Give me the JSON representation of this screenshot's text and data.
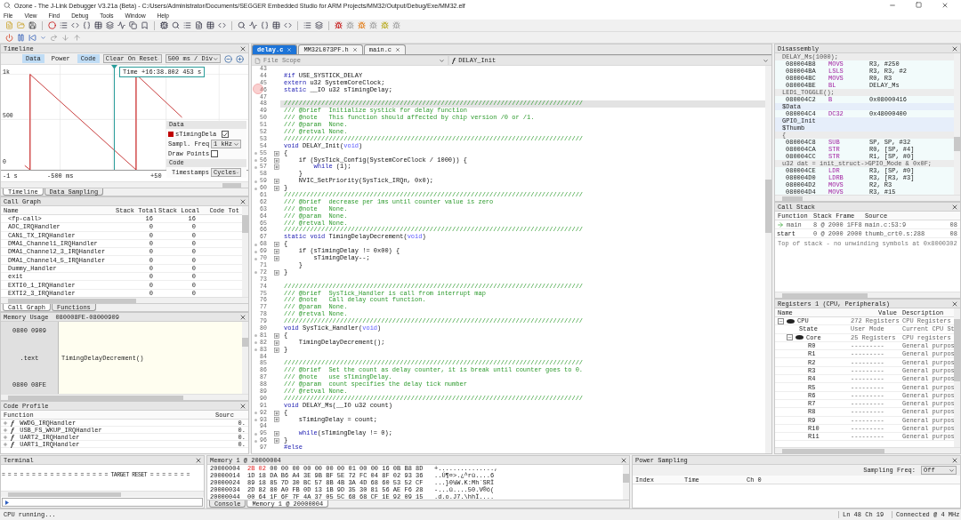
{
  "window": {
    "title": "Ozone - The J-Link Debugger V3.21a (Beta) - C:/Users/Administrator/Documents/SEGGER Embedded Studio for ARM Projects/MM32/Output/Debug/Exe/MM32.elf"
  },
  "menu": [
    "File",
    "View",
    "Find",
    "Debug",
    "Tools",
    "Window",
    "Help"
  ],
  "timeline": {
    "title": "Timeline",
    "modes": [
      {
        "label": "Data",
        "selected": true
      },
      {
        "label": "Power",
        "selected": false
      },
      {
        "label": "Code",
        "selected": true
      }
    ],
    "reset_mode": "Clear On Reset",
    "scale": "500 ms / Div",
    "cursor_time": "Time  +16:38.802 453 s",
    "y_labels": [
      "1k",
      "500",
      "0"
    ],
    "x_labels": [
      "-1 s",
      "-500 ms",
      "+50"
    ],
    "data_settings": {
      "title": "Data",
      "variable": "sTimingDela",
      "color": "#c00000",
      "visible": true,
      "freq_label": "Sampl. Freq",
      "freq": "1 kHz",
      "draw_points_label": "Draw Points",
      "draw_points": false
    },
    "code_settings": {
      "title": "Code",
      "timestamps_label": "Timestamps",
      "timestamps": "Cycles"
    },
    "tabs": [
      {
        "label": "Timeline",
        "selected": true
      },
      {
        "label": "Data Sampling",
        "selected": false
      }
    ]
  },
  "call_graph": {
    "title": "Call Graph",
    "columns": [
      "Name",
      "Stack Total",
      "Stack Local",
      "Code Tot"
    ],
    "rows": [
      [
        "<fp-call>",
        "16",
        "16"
      ],
      [
        "ADC_IRQHandler",
        "0",
        "0"
      ],
      [
        "CAN1_TX_IRQHandler",
        "0",
        "0"
      ],
      [
        "DMA1_Channel1_IRQHandler",
        "0",
        "0"
      ],
      [
        "DMA1_Channel2_3_IRQHandler",
        "0",
        "0"
      ],
      [
        "DMA1_Channel4_5_IRQHandler",
        "0",
        "0"
      ],
      [
        "Dummy_Handler",
        "0",
        "0"
      ],
      [
        "exit",
        "0",
        "0"
      ],
      [
        "EXTI0_1_IRQHandler",
        "0",
        "0"
      ],
      [
        "EXTI2_3_IRQHandler",
        "0",
        "0"
      ]
    ],
    "tabs": [
      {
        "label": "Call Graph",
        "selected": true
      },
      {
        "label": "Functions",
        "selected": false
      }
    ]
  },
  "memory_usage": {
    "title": "Memory Usage",
    "range": "080008FE-08000909",
    "end_address": "0800 0909",
    "section": ".text",
    "start_address": "0800 08FE",
    "symbol": "TimingDelayDecrement()"
  },
  "code_profile": {
    "title": "Code Profile",
    "columns": [
      "Function",
      "Sourc"
    ],
    "rows": [
      {
        "symbol": "ƒ",
        "name": "WWDG_IRQHandler",
        "source": "0."
      },
      {
        "symbol": "ƒ",
        "name": "USB_FS_WKUP_IRQHandler",
        "source": "0."
      },
      {
        "symbol": "ƒ",
        "name": "UART2_IRQHandler",
        "source": "0."
      },
      {
        "symbol": "ƒ",
        "name": "UART1_IRQHandler",
        "source": "0."
      }
    ]
  },
  "editor": {
    "tabs": [
      {
        "label": "delay.c",
        "selected": true
      },
      {
        "label": "MM32L073PF.h",
        "selected": false
      },
      {
        "label": "main.c",
        "selected": false
      }
    ],
    "scope": "File Scope",
    "scope_symbol": "ƒ",
    "function": "DELAY_Init",
    "lines": [
      {
        "n": "43",
        "current": false,
        "fold": false,
        "breakpoint": false
      },
      {
        "n": "44",
        "current": false,
        "fold": false,
        "breakpoint": false,
        "segs": [
          {
            "kind": "keyword",
            "text": "#if"
          },
          {
            "kind": "plain",
            "text": " USE_SYSTICK_DELAY"
          }
        ]
      },
      {
        "n": "45",
        "current": false,
        "fold": false,
        "breakpoint": false,
        "segs": [
          {
            "kind": "keyword",
            "text": "extern"
          },
          {
            "kind": "plain",
            "text": " u32 SystemCoreClock;"
          }
        ]
      },
      {
        "n": "46",
        "current": false,
        "fold": false,
        "breakpoint": true,
        "segs": [
          {
            "kind": "keyword",
            "text": "static"
          },
          {
            "kind": "plain",
            "text": " __IO u32 sTimingDelay;"
          }
        ]
      },
      {
        "n": "47",
        "current": false,
        "fold": false,
        "breakpoint": false
      },
      {
        "n": "48",
        "current": true,
        "fold": false,
        "breakpoint": false,
        "segs": [
          {
            "kind": "comment",
            "text": "////////////////////////////////////////////////////////////////////////////////"
          }
        ]
      },
      {
        "n": "49",
        "current": false,
        "fold": false,
        "breakpoint": false,
        "segs": [
          {
            "kind": "comment",
            "text": "/// @brief  Initialize systick for delay function"
          }
        ]
      },
      {
        "n": "50",
        "current": false,
        "fold": false,
        "breakpoint": false,
        "segs": [
          {
            "kind": "comment",
            "text": "/// @note   This function should affected by chip version /0 or /1."
          }
        ]
      },
      {
        "n": "51",
        "current": false,
        "fold": false,
        "breakpoint": false,
        "segs": [
          {
            "kind": "comment",
            "text": "/// @param  None."
          }
        ]
      },
      {
        "n": "52",
        "current": false,
        "fold": false,
        "breakpoint": false,
        "segs": [
          {
            "kind": "comment",
            "text": "/// @retval None."
          }
        ]
      },
      {
        "n": "53",
        "current": false,
        "fold": false,
        "breakpoint": false,
        "segs": [
          {
            "kind": "comment",
            "text": "////////////////////////////////////////////////////////////////////////////////"
          }
        ]
      },
      {
        "n": "54",
        "current": false,
        "fold": false,
        "breakpoint": false,
        "segs": [
          {
            "kind": "keyword",
            "text": "void"
          },
          {
            "kind": "plain",
            "text": " DELAY_Init("
          },
          {
            "kind": "type",
            "text": "void"
          },
          {
            "kind": "plain",
            "text": ")"
          }
        ]
      },
      {
        "n": "55",
        "current": false,
        "fold": true,
        "breakpoint": false,
        "segs": [
          {
            "kind": "plain",
            "text": "{"
          }
        ]
      },
      {
        "n": "56",
        "current": false,
        "fold": true,
        "breakpoint": false,
        "segs": [
          {
            "kind": "plain",
            "text": "    if (SysTick_Config(SystemCoreClock / 1000)) {"
          }
        ]
      },
      {
        "n": "57",
        "current": false,
        "fold": true,
        "breakpoint": false,
        "segs": [
          {
            "kind": "keyword",
            "text": "        while"
          },
          {
            "kind": "plain",
            "text": " (1);"
          }
        ]
      },
      {
        "n": "58",
        "current": false,
        "fold": false,
        "breakpoint": false,
        "segs": [
          {
            "kind": "plain",
            "text": "    }"
          }
        ]
      },
      {
        "n": "59",
        "current": false,
        "fold": true,
        "breakpoint": false,
        "segs": [
          {
            "kind": "plain",
            "text": "    NVIC_SetPriority(SysTick_IRQn, 0x0);"
          }
        ]
      },
      {
        "n": "60",
        "current": false,
        "fold": true,
        "breakpoint": false,
        "segs": [
          {
            "kind": "plain",
            "text": "}"
          }
        ]
      },
      {
        "n": "61",
        "current": false,
        "fold": false,
        "breakpoint": false,
        "segs": [
          {
            "kind": "comment",
            "text": "////////////////////////////////////////////////////////////////////////////////"
          }
        ]
      },
      {
        "n": "62",
        "current": false,
        "fold": false,
        "breakpoint": false,
        "segs": [
          {
            "kind": "comment",
            "text": "/// @brief  decrease per 1ms until counter value is zero"
          }
        ]
      },
      {
        "n": "63",
        "current": false,
        "fold": false,
        "breakpoint": false,
        "segs": [
          {
            "kind": "comment",
            "text": "/// @note   None."
          }
        ]
      },
      {
        "n": "64",
        "current": false,
        "fold": false,
        "breakpoint": false,
        "segs": [
          {
            "kind": "comment",
            "text": "/// @param  None."
          }
        ]
      },
      {
        "n": "65",
        "current": false,
        "fold": false,
        "breakpoint": false,
        "segs": [
          {
            "kind": "comment",
            "text": "/// @retval None."
          }
        ]
      },
      {
        "n": "66",
        "current": false,
        "fold": false,
        "breakpoint": false,
        "segs": [
          {
            "kind": "comment",
            "text": "////////////////////////////////////////////////////////////////////////////////"
          }
        ]
      },
      {
        "n": "67",
        "current": false,
        "fold": false,
        "breakpoint": false,
        "segs": [
          {
            "kind": "keyword",
            "text": "static void"
          },
          {
            "kind": "plain",
            "text": " TimingDelayDecrement("
          },
          {
            "kind": "type",
            "text": "void"
          },
          {
            "kind": "plain",
            "text": ")"
          }
        ]
      },
      {
        "n": "68",
        "current": false,
        "fold": true,
        "breakpoint": false,
        "segs": [
          {
            "kind": "plain",
            "text": "{"
          }
        ]
      },
      {
        "n": "69",
        "current": false,
        "fold": true,
        "breakpoint": false,
        "segs": [
          {
            "kind": "plain",
            "text": "    if (sTimingDelay != 0x00) {"
          }
        ]
      },
      {
        "n": "70",
        "current": false,
        "fold": true,
        "breakpoint": false,
        "segs": [
          {
            "kind": "plain",
            "text": "        sTimingDelay--;"
          }
        ]
      },
      {
        "n": "71",
        "current": false,
        "fold": false,
        "breakpoint": false,
        "segs": [
          {
            "kind": "plain",
            "text": "    }"
          }
        ]
      },
      {
        "n": "72",
        "current": false,
        "fold": true,
        "breakpoint": false,
        "segs": [
          {
            "kind": "plain",
            "text": "}"
          }
        ]
      },
      {
        "n": "73",
        "current": false,
        "fold": false,
        "breakpoint": false
      },
      {
        "n": "74",
        "current": false,
        "fold": false,
        "breakpoint": false,
        "segs": [
          {
            "kind": "comment",
            "text": "////////////////////////////////////////////////////////////////////////////////"
          }
        ]
      },
      {
        "n": "75",
        "current": false,
        "fold": false,
        "breakpoint": false,
        "segs": [
          {
            "kind": "comment",
            "text": "/// @brief  SysTick_Handler is call from interrupt map"
          }
        ]
      },
      {
        "n": "76",
        "current": false,
        "fold": false,
        "breakpoint": false,
        "segs": [
          {
            "kind": "comment",
            "text": "/// @note   Call delay count function."
          }
        ]
      },
      {
        "n": "77",
        "current": false,
        "fold": false,
        "breakpoint": false,
        "segs": [
          {
            "kind": "comment",
            "text": "/// @param  None."
          }
        ]
      },
      {
        "n": "78",
        "current": false,
        "fold": false,
        "breakpoint": false,
        "segs": [
          {
            "kind": "comment",
            "text": "/// @retval None."
          }
        ]
      },
      {
        "n": "79",
        "current": false,
        "fold": false,
        "breakpoint": false,
        "segs": [
          {
            "kind": "comment",
            "text": "////////////////////////////////////////////////////////////////////////////////"
          }
        ]
      },
      {
        "n": "80",
        "current": false,
        "fold": false,
        "breakpoint": false,
        "segs": [
          {
            "kind": "keyword",
            "text": "void"
          },
          {
            "kind": "plain",
            "text": " SysTick_Handler("
          },
          {
            "kind": "type",
            "text": "void"
          },
          {
            "kind": "plain",
            "text": ")"
          }
        ]
      },
      {
        "n": "81",
        "current": false,
        "fold": true,
        "breakpoint": false,
        "segs": [
          {
            "kind": "plain",
            "text": "{"
          }
        ]
      },
      {
        "n": "82",
        "current": false,
        "fold": true,
        "breakpoint": false,
        "segs": [
          {
            "kind": "plain",
            "text": "    TimingDelayDecrement();"
          }
        ]
      },
      {
        "n": "83",
        "current": false,
        "fold": true,
        "breakpoint": false,
        "segs": [
          {
            "kind": "plain",
            "text": "}"
          }
        ]
      },
      {
        "n": "84",
        "current": false,
        "fold": false,
        "breakpoint": false
      },
      {
        "n": "85",
        "current": false,
        "fold": false,
        "breakpoint": false,
        "segs": [
          {
            "kind": "comment",
            "text": "////////////////////////////////////////////////////////////////////////////////"
          }
        ]
      },
      {
        "n": "86",
        "current": false,
        "fold": false,
        "breakpoint": false,
        "segs": [
          {
            "kind": "comment",
            "text": "/// @brief  Set the count as delay counter, it is break until counter goes to 0."
          }
        ]
      },
      {
        "n": "87",
        "current": false,
        "fold": false,
        "breakpoint": false,
        "segs": [
          {
            "kind": "comment",
            "text": "/// @note   use sTimingDelay."
          }
        ]
      },
      {
        "n": "88",
        "current": false,
        "fold": false,
        "breakpoint": false,
        "segs": [
          {
            "kind": "comment",
            "text": "/// @param  count specifies the delay tick number"
          }
        ]
      },
      {
        "n": "89",
        "current": false,
        "fold": false,
        "breakpoint": false,
        "segs": [
          {
            "kind": "comment",
            "text": "/// @retval None."
          }
        ]
      },
      {
        "n": "90",
        "current": false,
        "fold": false,
        "breakpoint": false,
        "segs": [
          {
            "kind": "comment",
            "text": "////////////////////////////////////////////////////////////////////////////////"
          }
        ]
      },
      {
        "n": "91",
        "current": false,
        "fold": false,
        "breakpoint": false,
        "segs": [
          {
            "kind": "keyword",
            "text": "void"
          },
          {
            "kind": "plain",
            "text": " DELAY_Ms(__IO u32 count)"
          }
        ]
      },
      {
        "n": "92",
        "current": false,
        "fold": true,
        "breakpoint": false,
        "segs": [
          {
            "kind": "plain",
            "text": "{"
          }
        ]
      },
      {
        "n": "93",
        "current": false,
        "fold": true,
        "breakpoint": false,
        "segs": [
          {
            "kind": "plain",
            "text": "    sTimingDelay = count;"
          }
        ]
      },
      {
        "n": "94",
        "current": false,
        "fold": false,
        "breakpoint": false
      },
      {
        "n": "95",
        "current": false,
        "fold": true,
        "breakpoint": false,
        "segs": [
          {
            "kind": "keyword",
            "text": "    while"
          },
          {
            "kind": "plain",
            "text": "(sTimingDelay != 0);"
          }
        ]
      },
      {
        "n": "96",
        "current": false,
        "fold": true,
        "breakpoint": false,
        "segs": [
          {
            "kind": "plain",
            "text": "}"
          }
        ]
      },
      {
        "n": "97",
        "current": false,
        "fold": false,
        "breakpoint": false,
        "segs": [
          {
            "kind": "keyword",
            "text": "#else"
          }
        ]
      }
    ]
  },
  "disassembly": {
    "title": "Disassembly",
    "rows": [
      {
        "kind": "source",
        "text": "DELAY_Ms(1000);"
      },
      {
        "kind": "instr",
        "address": "080004B8",
        "mnemonic": "MOVS",
        "operands": "R3, #250"
      },
      {
        "kind": "instr",
        "address": "080004BA",
        "mnemonic": "LSLS",
        "operands": "R3, R3, #2"
      },
      {
        "kind": "instr",
        "address": "080004BC",
        "mnemonic": "MOVS",
        "operands": "R0, R3"
      },
      {
        "kind": "instr",
        "address": "080004BE",
        "mnemonic": "BL",
        "operands": "DELAY_Ms"
      },
      {
        "kind": "source",
        "text": "LED1_TOGGLE();"
      },
      {
        "kind": "instr",
        "address": "080004C2",
        "mnemonic": "B",
        "operands": "0x08000416"
      },
      {
        "kind": "label",
        "text": "$Data"
      },
      {
        "kind": "instr",
        "address": "080004C4",
        "mnemonic": "DC32",
        "operands": "0x48000400"
      },
      {
        "kind": "label",
        "text": "GPIO_Init"
      },
      {
        "kind": "label",
        "text": "$Thumb"
      },
      {
        "kind": "source",
        "text": "{"
      },
      {
        "kind": "instr",
        "address": "080004C8",
        "mnemonic": "SUB",
        "operands": "SP, SP, #32"
      },
      {
        "kind": "instr",
        "address": "080004CA",
        "mnemonic": "STR",
        "operands": "R0, [SP, #4]"
      },
      {
        "kind": "instr",
        "address": "080004CC",
        "mnemonic": "STR",
        "operands": "R1, [SP, #0]"
      },
      {
        "kind": "source",
        "text": "u32 dat = init_struct->GPIO_Mode & 0x0F;"
      },
      {
        "kind": "instr",
        "address": "080004CE",
        "mnemonic": "LDR",
        "operands": "R3, [SP, #0]"
      },
      {
        "kind": "instr",
        "address": "080004D0",
        "mnemonic": "LDRB",
        "operands": "R3, [R3, #3]"
      },
      {
        "kind": "instr",
        "address": "080004D2",
        "mnemonic": "MOVS",
        "operands": "R2, R3"
      },
      {
        "kind": "instr",
        "address": "080004D4",
        "mnemonic": "MOVS",
        "operands": "R3, #15"
      }
    ]
  },
  "call_stack": {
    "title": "Call Stack",
    "columns": [
      "Function",
      "Stack Frame",
      "Source"
    ],
    "rows": [
      {
        "function": "main",
        "frame": "8 @ 2000 1FF8",
        "source": "main.c:53:9",
        "column_4": "08",
        "current": true
      },
      {
        "function": "start",
        "frame": "0 @ 2000 2000",
        "source": "thumb_crt0.s:288",
        "column_4": "08",
        "current": false
      }
    ],
    "note": "Top of stack - no unwinding symbols at 0x8000302"
  },
  "registers": {
    "title": "Registers 1 (CPU, Peripherals)",
    "columns": [
      "Name",
      "Value",
      "Description"
    ],
    "items": [
      {
        "name": "CPU",
        "value": "272 Registers",
        "description": "CPU Registers",
        "expanded": true,
        "children": [
          {
            "name": "State",
            "value": "User Mode",
            "description": "Current CPU St"
          },
          {
            "name": "Core",
            "value": "25 Registers",
            "description": "CPU registers",
            "expanded": true,
            "children": [
              {
                "name": "R0",
                "value": "---------",
                "description": "General purpos"
              },
              {
                "name": "R1",
                "value": "---------",
                "description": "General purpos"
              },
              {
                "name": "R2",
                "value": "---------",
                "description": "General purpos"
              },
              {
                "name": "R3",
                "value": "---------",
                "description": "General purpos"
              },
              {
                "name": "R4",
                "value": "---------",
                "description": "General purpos"
              },
              {
                "name": "R5",
                "value": "---------",
                "description": "General purpos"
              },
              {
                "name": "R6",
                "value": "---------",
                "description": "General purpos"
              },
              {
                "name": "R7",
                "value": "---------",
                "description": "General purpos"
              },
              {
                "name": "R8",
                "value": "---------",
                "description": "General purpos"
              },
              {
                "name": "R9",
                "value": "---------",
                "description": "General purpos"
              },
              {
                "name": "R10",
                "value": "---------",
                "description": "General purpos"
              },
              {
                "name": "R11",
                "value": "---------",
                "description": "General purpos"
              }
            ]
          }
        ]
      }
    ]
  },
  "terminal": {
    "title": "Terminal",
    "lines": [
      "= = = = = = = = = = = = = = = = = = TARGET RESET = = = = = = ="
    ]
  },
  "memory": {
    "title": "Memory 1 @ 20000004",
    "rows": [
      {
        "address": "20000004",
        "changed": "2B 02",
        "bytes": "00 00 00 00 00 00  00 01 00 00 16 0B B8 8D",
        "ascii": "+...............,"
      },
      {
        "address": "20000014",
        "bytes": "1D 18 DA B6 A4 3E 9B BF  5E 72 FC 04 8F 02 93 36",
        "ascii": "..Ú¶¤>.¿^rü....6"
      },
      {
        "address": "20000024",
        "bytes": "89 18 85 7D 30 BC 57 8B  4B 3A 4D 68 60 53 52 CF",
        "ascii": "...}0¼W.K:Mh`SRÏ"
      },
      {
        "address": "20000034",
        "bytes": "2D 82 80 A0 FB 0D 13 1B  9D 35 30 81 56 AE F6 28",
        "ascii": "-...û....50.V®ö("
      },
      {
        "address": "20000044",
        "bytes": "00 64 1F 6F 7F 4A 37 05  5C 68 68 CF 1E 92 09 15",
        "ascii": ".d.o.J7.\\hhÏ...."
      }
    ],
    "tabs": [
      {
        "label": "Console",
        "selected": false
      },
      {
        "label": "Memory 1 @ 20000004",
        "selected": true
      }
    ]
  },
  "power": {
    "title": "Power Sampling",
    "freq_label": "Sampling Freq:",
    "freq": "Off",
    "columns": [
      "Index",
      "Time",
      "Ch 0"
    ]
  },
  "status_bar": {
    "message": "CPU running...",
    "position": "Ln 48  Ch 19",
    "connection": "Connected @ 4 MHz"
  }
}
